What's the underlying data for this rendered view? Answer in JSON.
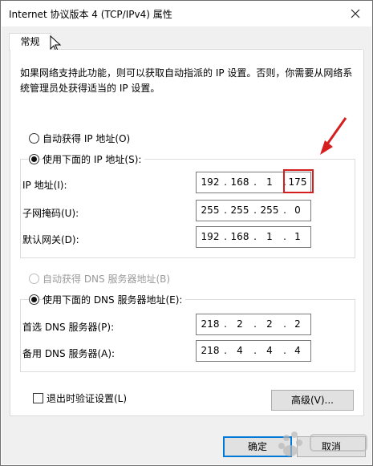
{
  "window": {
    "title": "Internet 协议版本 4 (TCP/IPv4) 属性"
  },
  "icons": {
    "close": "close-icon",
    "cursor": "mouse-pointer-icon",
    "arrow": "red-arrow-annotation"
  },
  "tabs": [
    {
      "label": "常规"
    }
  ],
  "description": "如果网络支持此功能，则可以获取自动指派的 IP 设置。否则，你需要从网络系统管理员处获得适当的 IP 设置。",
  "ip_mode": {
    "auto_label": "自动获得 IP 地址(O)",
    "manual_label": "使用下面的 IP 地址(S):",
    "selected": "manual"
  },
  "ip_fields": [
    {
      "label": "IP 地址(I):",
      "octets": [
        "192",
        "168",
        "1",
        "175"
      ]
    },
    {
      "label": "子网掩码(U):",
      "octets": [
        "255",
        "255",
        "255",
        "0"
      ]
    },
    {
      "label": "默认网关(D):",
      "octets": [
        "192",
        "168",
        "1",
        "1"
      ]
    }
  ],
  "dns_mode": {
    "auto_label": "自动获得 DNS 服务器地址(B)",
    "manual_label": "使用下面的 DNS 服务器地址(E):",
    "selected": "manual"
  },
  "dns_fields": [
    {
      "label": "首选 DNS 服务器(P):",
      "octets": [
        "218",
        "2",
        "2",
        "2"
      ]
    },
    {
      "label": "备用 DNS 服务器(A):",
      "octets": [
        "218",
        "4",
        "4",
        "4"
      ]
    }
  ],
  "validate_on_exit": {
    "label": "退出时验证设置(L)",
    "checked": false
  },
  "buttons": {
    "advanced": "高级(V)...",
    "ok": "确定",
    "cancel": "取消"
  },
  "colors": {
    "annotation": "#d51f1f",
    "dialog_bg": "#f0f0f0",
    "accent": "#0078d7"
  }
}
